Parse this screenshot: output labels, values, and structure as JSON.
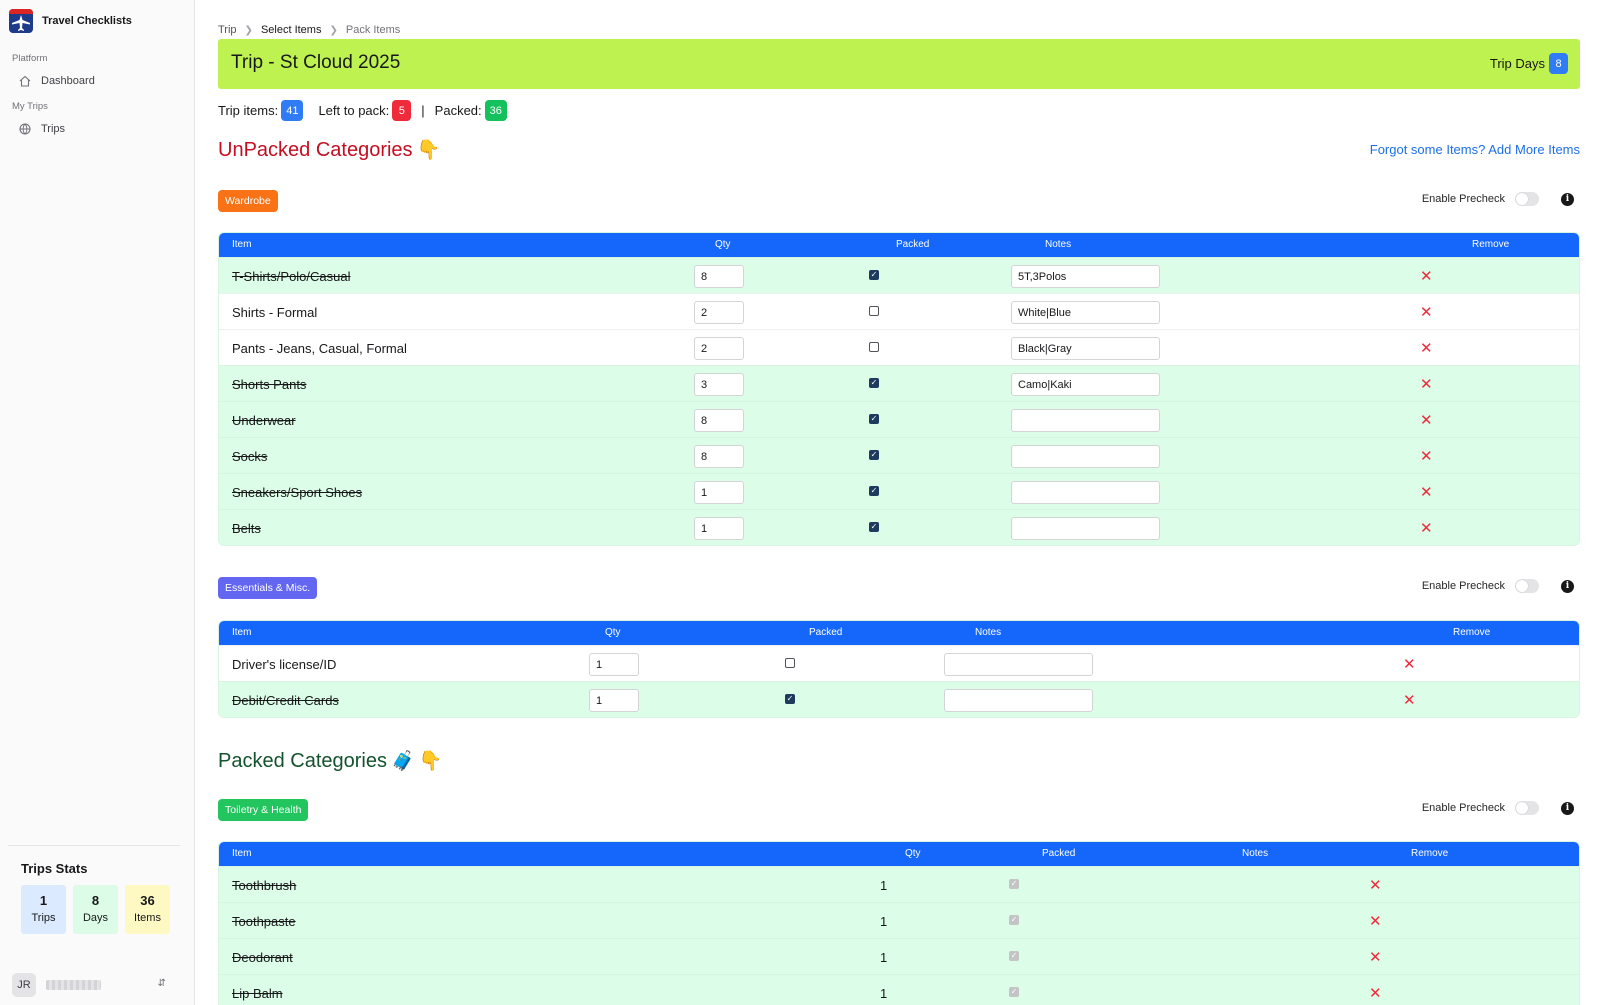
{
  "sidebar": {
    "brand": "Travel Checklists",
    "section_platform": "Platform",
    "dashboard": "Dashboard",
    "section_trips": "My Trips",
    "trips": "Trips",
    "stats_title": "Trips Stats",
    "stats": [
      {
        "value": "1",
        "label": "Trips",
        "color": "#dbeafe"
      },
      {
        "value": "8",
        "label": "Days",
        "color": "#dcfce7"
      },
      {
        "value": "36",
        "label": "Items",
        "color": "#fef9c3"
      }
    ],
    "user_initials": "JR"
  },
  "breadcrumb": [
    "Trip",
    "Select Items",
    "Pack Items"
  ],
  "trip": {
    "title": "Trip - St Cloud 2025",
    "days_label": "Trip Days",
    "days": "8"
  },
  "counts": {
    "items_label": "Trip items:",
    "items": "41",
    "left_label": "Left to pack:",
    "left": "5",
    "sep": "|",
    "packed_label": "Packed:",
    "packed": "36"
  },
  "unpacked_title": "UnPacked Categories",
  "packed_title": "Packed Categories",
  "add_more": "Forgot some Items? Add More Items",
  "precheck_label": "Enable Precheck",
  "headers": {
    "item": "Item",
    "qty": "Qty",
    "packed": "Packed",
    "notes": "Notes",
    "remove": "Remove"
  },
  "categories": {
    "wardrobe": {
      "name": "Wardrobe",
      "color": "#f97316",
      "rows": [
        {
          "item": "T-Shirts/Polo/Casual",
          "qty": "8",
          "packed": true,
          "notes": "5T,3Polos"
        },
        {
          "item": "Shirts - Formal",
          "qty": "2",
          "packed": false,
          "notes": "White|Blue"
        },
        {
          "item": "Pants - Jeans, Casual, Formal",
          "qty": "2",
          "packed": false,
          "notes": "Black|Gray"
        },
        {
          "item": "Shorts Pants",
          "qty": "3",
          "packed": true,
          "notes": "Camo|Kaki"
        },
        {
          "item": "Underwear",
          "qty": "8",
          "packed": true,
          "notes": ""
        },
        {
          "item": "Socks",
          "qty": "8",
          "packed": true,
          "notes": ""
        },
        {
          "item": "Sneakers/Sport Shoes",
          "qty": "1",
          "packed": true,
          "notes": ""
        },
        {
          "item": "Belts",
          "qty": "1",
          "packed": true,
          "notes": ""
        }
      ]
    },
    "essentials": {
      "name": "Essentials & Misc.",
      "color": "#6366f1",
      "rows": [
        {
          "item": "Driver's license/ID",
          "qty": "1",
          "packed": false,
          "notes": ""
        },
        {
          "item": "Debit/Credit Cards",
          "qty": "1",
          "packed": true,
          "notes": ""
        }
      ]
    },
    "toiletry": {
      "name": "Toiletry & Health",
      "color": "#22c55e",
      "rows": [
        {
          "item": "Toothbrush",
          "qty": "1",
          "packed": true
        },
        {
          "item": "Toothpaste",
          "qty": "1",
          "packed": true
        },
        {
          "item": "Deodorant",
          "qty": "1",
          "packed": true
        },
        {
          "item": "Lip Balm",
          "qty": "1",
          "packed": true
        }
      ]
    }
  },
  "icons": {
    "remove": "close-icon",
    "info": "info-icon",
    "hand": "pointing-down-hand-icon",
    "luggage": "luggage-icon"
  }
}
